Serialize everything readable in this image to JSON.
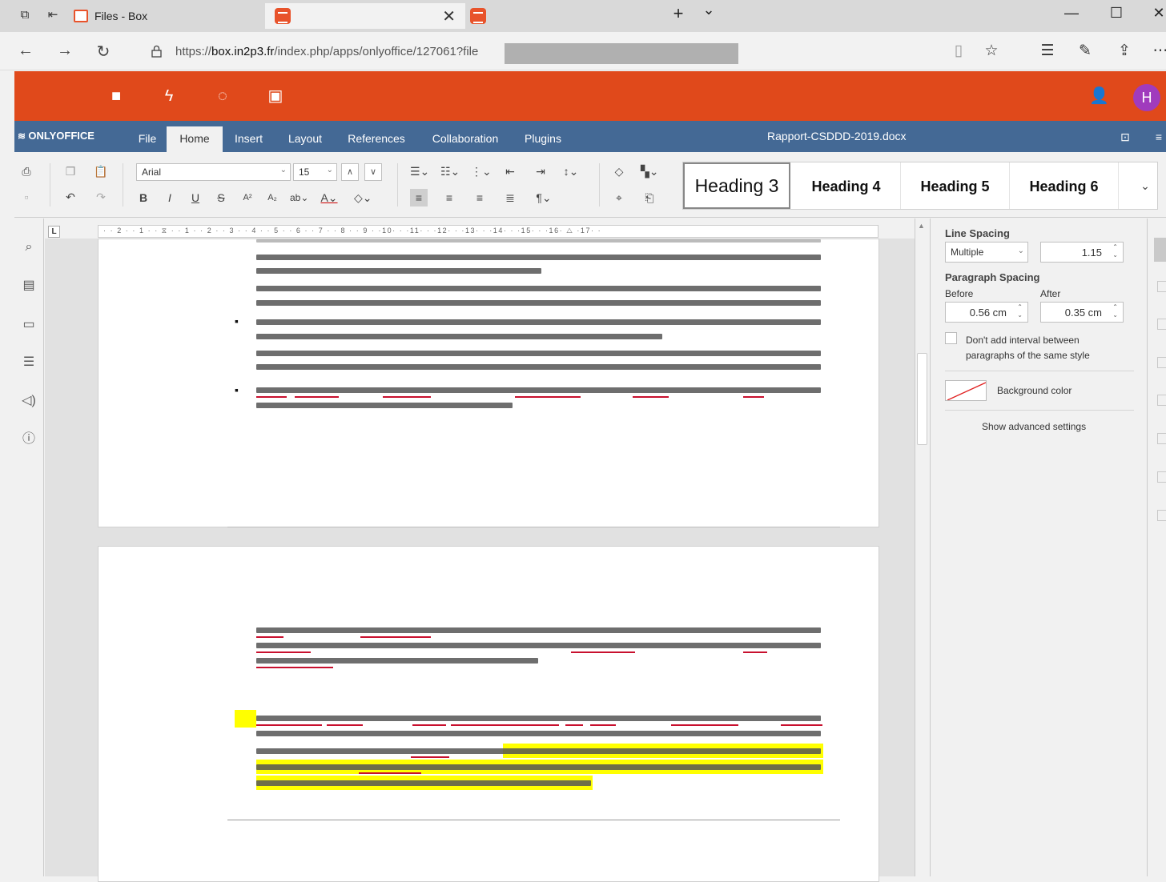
{
  "browser": {
    "tabs": [
      {
        "title": "Files - Box",
        "close": ""
      },
      {
        "title": "",
        "close": "✕"
      },
      {
        "title": "",
        "close": ""
      }
    ],
    "new_tab": "+",
    "tab_menu": "⌄",
    "window": {
      "minimize": "—",
      "maximize": "☐",
      "close": "✕"
    },
    "url_prefix": "https://",
    "url_host": "box.in2p3.fr",
    "url_path": "/index.php/apps/onlyoffice/127061?file"
  },
  "app": {
    "avatar_letter": "H",
    "brand": "ONLYOFFICE",
    "doc_title": "Rapport-CSDDD-2019.docx",
    "menu": [
      "File",
      "Home",
      "Insert",
      "Layout",
      "References",
      "Collaboration",
      "Plugins"
    ],
    "active_menu": "Home"
  },
  "toolbar": {
    "font_name": "Arial",
    "font_size": "15",
    "styles": [
      "Heading 3",
      "Heading 4",
      "Heading 5",
      "Heading 6"
    ]
  },
  "ruler": {
    "corner": "L",
    "marks": "· · 2 · · 1 · · ⧖ · · 1 · · 2 · · 3 · · 4 · · 5 · · 6 · · 7 · · 8 · · 9 · ·10· · ·11· · ·12· · ·13· · ·14· · ·15· · ·16· △ ·17· ·"
  },
  "panel": {
    "line_spacing_label": "Line Spacing",
    "line_spacing_mode": "Multiple",
    "line_spacing_value": "1.15",
    "paragraph_spacing_label": "Paragraph Spacing",
    "before_label": "Before",
    "after_label": "After",
    "before_value": "0.56 cm",
    "after_value": "0.35 cm",
    "no_interval_label": "Don't add interval between paragraphs of the same style",
    "bg_color_label": "Background color",
    "advanced_label": "Show advanced settings"
  },
  "colors": {
    "brand_orange": "#e0491b",
    "oo_blue": "#446995",
    "highlight": "#ffff00",
    "spell_red": "#c8102e",
    "avatar": "#a03bbd"
  }
}
